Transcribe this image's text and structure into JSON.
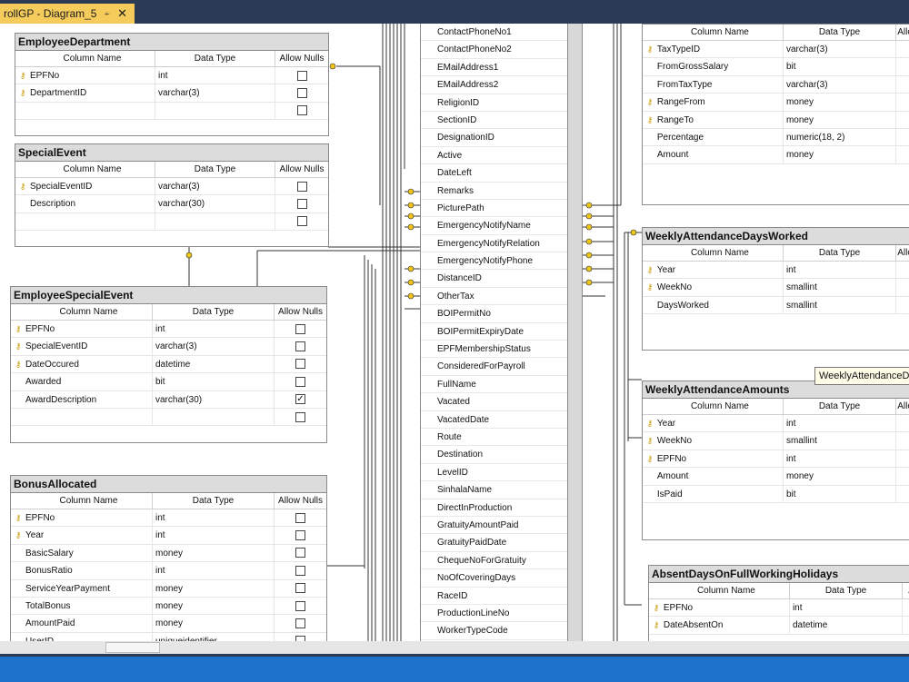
{
  "window": {
    "tab_title": "rollGP - Diagram_5",
    "tab_pin": "⍅",
    "tab_close": "✕"
  },
  "colors": {
    "titlebar": "#2b3a55",
    "tab_active": "#f5cc5c",
    "statusbar": "#1d72c9",
    "key_icon": "#c69a00",
    "table_header": "#dcdcdc"
  },
  "tooltip": "WeeklyAttendanceDay",
  "headers": {
    "column_name": "Column Name",
    "data_type": "Data Type",
    "allow_nulls": "Allow Nulls",
    "allow_nulls_cut": "Allo",
    "allow_nulls_short": "A"
  },
  "employee_columns": {
    "rows": [
      "ContactPhoneNo1",
      "ContactPhoneNo2",
      "EMailAddress1",
      "EMailAddress2",
      "ReligionID",
      "SectionID",
      "DesignationID",
      "Active",
      "DateLeft",
      "Remarks",
      "PicturePath",
      "EmergencyNotifyName",
      "EmergencyNotifyRelation",
      "EmergencyNotifyPhone",
      "DistanceID",
      "OtherTax",
      "BOIPermitNo",
      "BOIPermitExpiryDate",
      "EPFMembershipStatus",
      "ConsideredForPayroll",
      "FullName",
      "Vacated",
      "VacatedDate",
      "Route",
      "Destination",
      "LevelID",
      "SinhalaName",
      "DirectInProduction",
      "GratuityAmountPaid",
      "GratuityPaidDate",
      "ChequeNoForGratuity",
      "NoOfCoveringDays",
      "RaceID",
      "ProductionLineNo",
      "WorkerTypeCode"
    ]
  },
  "tables": {
    "employee_department": {
      "title": "EmployeeDepartment",
      "rows": [
        {
          "key": true,
          "name": "EPFNo",
          "type": "int",
          "nulls": "empty"
        },
        {
          "key": true,
          "name": "DepartmentID",
          "type": "varchar(3)",
          "nulls": "empty"
        },
        {
          "key": false,
          "name": "",
          "type": "",
          "nulls": "empty"
        }
      ]
    },
    "special_event": {
      "title": "SpecialEvent",
      "rows": [
        {
          "key": true,
          "name": "SpecialEventID",
          "type": "varchar(3)",
          "nulls": "empty"
        },
        {
          "key": false,
          "name": "Description",
          "type": "varchar(30)",
          "nulls": "empty"
        },
        {
          "key": false,
          "name": "",
          "type": "",
          "nulls": "empty"
        }
      ]
    },
    "employee_special_event": {
      "title": "EmployeeSpecialEvent",
      "rows": [
        {
          "key": true,
          "name": "EPFNo",
          "type": "int",
          "nulls": "empty"
        },
        {
          "key": true,
          "name": "SpecialEventID",
          "type": "varchar(3)",
          "nulls": "empty"
        },
        {
          "key": true,
          "name": "DateOccured",
          "type": "datetime",
          "nulls": "empty"
        },
        {
          "key": false,
          "name": "Awarded",
          "type": "bit",
          "nulls": "empty"
        },
        {
          "key": false,
          "name": "AwardDescription",
          "type": "varchar(30)",
          "nulls": "checked"
        },
        {
          "key": false,
          "name": "",
          "type": "",
          "nulls": "empty"
        }
      ]
    },
    "bonus_allocated": {
      "title": "BonusAllocated",
      "rows": [
        {
          "key": true,
          "name": "EPFNo",
          "type": "int",
          "nulls": "empty"
        },
        {
          "key": true,
          "name": "Year",
          "type": "int",
          "nulls": "empty"
        },
        {
          "key": false,
          "name": "BasicSalary",
          "type": "money",
          "nulls": "empty"
        },
        {
          "key": false,
          "name": "BonusRatio",
          "type": "int",
          "nulls": "empty"
        },
        {
          "key": false,
          "name": "ServiceYearPayment",
          "type": "money",
          "nulls": "empty"
        },
        {
          "key": false,
          "name": "TotalBonus",
          "type": "money",
          "nulls": "empty"
        },
        {
          "key": false,
          "name": "AmountPaid",
          "type": "money",
          "nulls": "empty"
        },
        {
          "key": false,
          "name": "UserID",
          "type": "uniqueidentifier",
          "nulls": "empty"
        }
      ]
    },
    "tax_table": {
      "title": "",
      "rows": [
        {
          "key": true,
          "name": "TaxTypeID",
          "type": "varchar(3)"
        },
        {
          "key": false,
          "name": "FromGrossSalary",
          "type": "bit"
        },
        {
          "key": false,
          "name": "FromTaxType",
          "type": "varchar(3)"
        },
        {
          "key": true,
          "name": "RangeFrom",
          "type": "money"
        },
        {
          "key": true,
          "name": "RangeTo",
          "type": "money"
        },
        {
          "key": false,
          "name": "Percentage",
          "type": "numeric(18, 2)"
        },
        {
          "key": false,
          "name": "Amount",
          "type": "money"
        }
      ]
    },
    "weekly_days_worked": {
      "title": "WeeklyAttendanceDaysWorked",
      "rows": [
        {
          "key": true,
          "name": "Year",
          "type": "int"
        },
        {
          "key": true,
          "name": "WeekNo",
          "type": "smallint"
        },
        {
          "key": false,
          "name": "DaysWorked",
          "type": "smallint"
        }
      ]
    },
    "weekly_amounts": {
      "title": "WeeklyAttendanceAmounts",
      "rows": [
        {
          "key": true,
          "name": "Year",
          "type": "int"
        },
        {
          "key": true,
          "name": "WeekNo",
          "type": "smallint"
        },
        {
          "key": true,
          "name": "EPFNo",
          "type": "int"
        },
        {
          "key": false,
          "name": "Amount",
          "type": "money"
        },
        {
          "key": false,
          "name": "IsPaid",
          "type": "bit"
        }
      ]
    },
    "absent_days": {
      "title": "AbsentDaysOnFullWorkingHolidays",
      "rows": [
        {
          "key": true,
          "name": "EPFNo",
          "type": "int"
        },
        {
          "key": true,
          "name": "DateAbsentOn",
          "type": "datetime"
        }
      ]
    }
  }
}
